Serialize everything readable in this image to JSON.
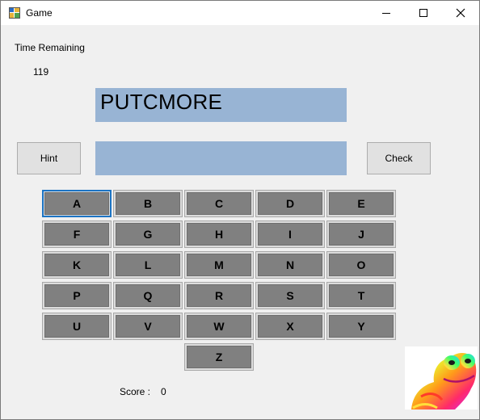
{
  "window": {
    "title": "Game"
  },
  "timer": {
    "label": "Time Remaining",
    "value": "119"
  },
  "scramble": {
    "text": "PUTCMORE"
  },
  "answer": {
    "value": ""
  },
  "buttons": {
    "hint": "Hint",
    "check": "Check"
  },
  "keys": [
    "A",
    "B",
    "C",
    "D",
    "E",
    "F",
    "G",
    "H",
    "I",
    "J",
    "K",
    "L",
    "M",
    "N",
    "O",
    "P",
    "Q",
    "R",
    "S",
    "T",
    "U",
    "V",
    "W",
    "X",
    "Y",
    "Z"
  ],
  "score": {
    "label": "Score :",
    "value": "0"
  },
  "colors": {
    "scramble_box": "#98b4d4",
    "key_face": "#808080",
    "focus": "#1c74c4"
  }
}
